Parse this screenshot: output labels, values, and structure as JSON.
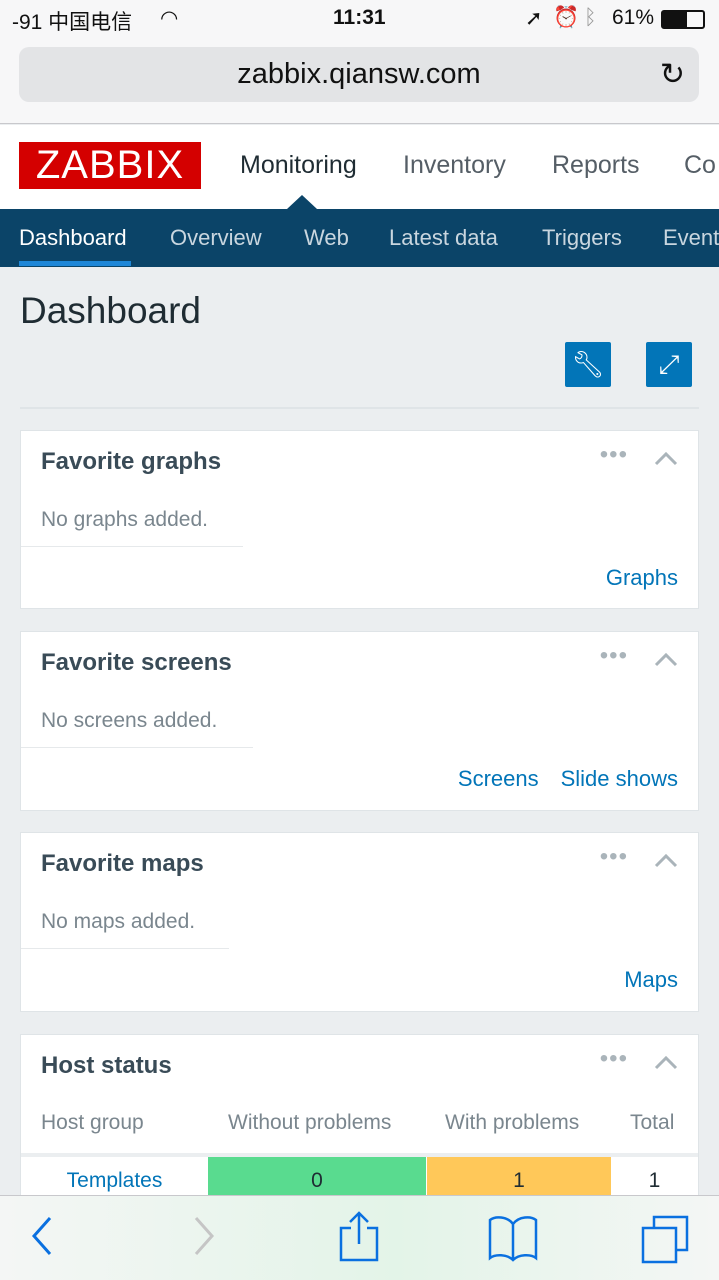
{
  "status_bar": {
    "carrier": "-91 中国电信",
    "time": "11:31",
    "battery": "61%"
  },
  "browser": {
    "url": "zabbix.qiansw.com"
  },
  "header": {
    "logo": "ZABBIX",
    "nav": [
      "Monitoring",
      "Inventory",
      "Reports",
      "Co"
    ]
  },
  "subnav": [
    "Dashboard",
    "Overview",
    "Web",
    "Latest data",
    "Triggers",
    "Event"
  ],
  "page_title": "Dashboard",
  "widgets": {
    "graphs": {
      "title": "Favorite graphs",
      "empty": "No graphs added.",
      "links": [
        "Graphs"
      ]
    },
    "screens": {
      "title": "Favorite screens",
      "empty": "No screens added.",
      "links": [
        "Screens",
        "Slide shows"
      ]
    },
    "maps": {
      "title": "Favorite maps",
      "empty": "No maps added.",
      "links": [
        "Maps"
      ]
    },
    "host_status": {
      "title": "Host status",
      "columns": [
        "Host group",
        "Without problems",
        "With problems",
        "Total"
      ],
      "rows": [
        {
          "group": "Templates",
          "without": "0",
          "with": "1",
          "total": "1"
        }
      ]
    }
  },
  "colors": {
    "ok": "#59db8f",
    "problem": "#ffc859",
    "accent": "#0275b8",
    "nav": "#0b4468",
    "logo": "#d40000"
  }
}
